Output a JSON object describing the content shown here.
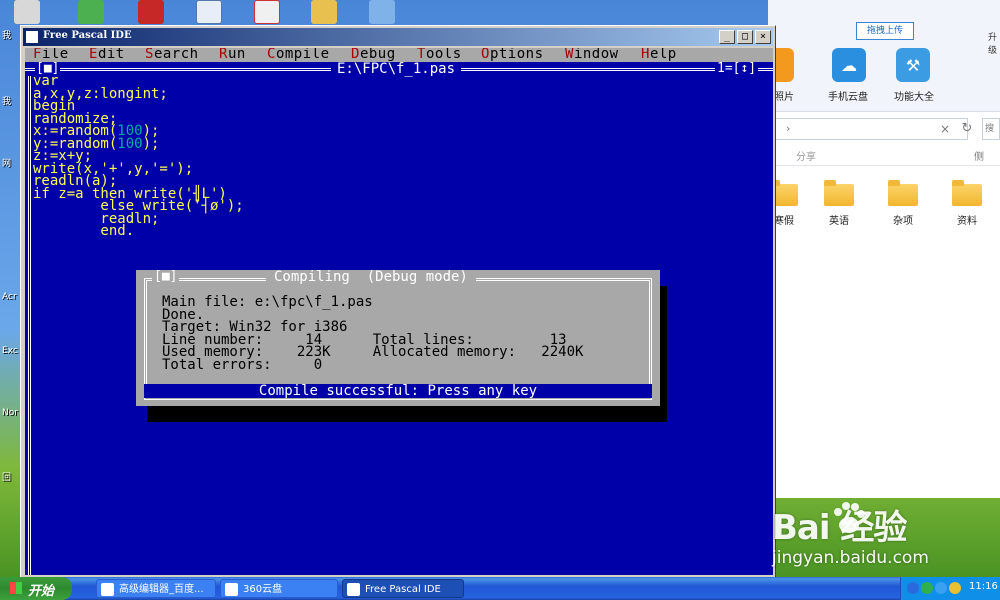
{
  "desktop": {
    "side_labels": [
      "我",
      "我",
      "网",
      "Acr",
      "Exc",
      "Nor",
      "回",
      "我"
    ],
    "icons": [
      "word-doc-icon",
      "pdf-icon",
      "wps-icon",
      "360-icon",
      "app-icon",
      "folder-icon"
    ]
  },
  "bg_window": {
    "upload_label": "拖拽上传",
    "right_tag": "升级",
    "tools": [
      {
        "label": "照片",
        "icon": "photo-icon",
        "color": "#f39a1e"
      },
      {
        "label": "手机云盘",
        "icon": "cloud-icon",
        "color": "#2b8fe0"
      },
      {
        "label": "功能大全",
        "icon": "tools-icon",
        "color": "#3b9ce4"
      }
    ],
    "search_placeholder": "搜",
    "share_label": "分享",
    "view_label": "侧",
    "folders": [
      "寒假",
      "英语",
      "杂项",
      "资料"
    ]
  },
  "ide": {
    "window_title": "Free Pascal IDE",
    "menu": [
      {
        "hot": "F",
        "rest": "ile"
      },
      {
        "hot": "E",
        "rest": "dit"
      },
      {
        "hot": "S",
        "rest": "earch"
      },
      {
        "hot": "R",
        "rest": "un"
      },
      {
        "hot": "C",
        "rest": "ompile"
      },
      {
        "hot": "D",
        "rest": "ebug"
      },
      {
        "hot": "T",
        "rest": "ools"
      },
      {
        "hot": "O",
        "rest": "ptions"
      },
      {
        "hot": "W",
        "rest": "indow"
      },
      {
        "hot": "H",
        "rest": "elp"
      }
    ],
    "editor_close": "[■]",
    "file_name": "E:\\FPC\\f_1.pas",
    "window_number": "1=[↕]",
    "code_lines": [
      "var",
      "a,x,y,z:longint;",
      "begin",
      "randomize;",
      "x:=random(100);",
      "y:=random(100);",
      "z:=x+y;",
      "write(x,'+',y,'=');",
      "readln(a);",
      "if z=a then write('╢L')",
      "        else write('┤ø');",
      "        readln;",
      "        end."
    ],
    "dialog": {
      "close": "[■]",
      "title": "Compiling  (Debug mode)",
      "lines": [
        "Main file: e:\\fpc\\f_1.pas",
        "Done.",
        "Target: Win32 for i386",
        "Line number:     14      Total lines:         13",
        "Used memory:    223K     Allocated memory:   2240K",
        "Total errors:     0"
      ],
      "status": "Compile successful: Press any key"
    }
  },
  "taskbar": {
    "start_label": "开始",
    "tasks": [
      {
        "label": "高级编辑器_百度...",
        "active": false
      },
      {
        "label": "360云盘",
        "active": false
      },
      {
        "label": "Free Pascal IDE",
        "active": true
      }
    ],
    "clock": "11:16"
  },
  "watermark": {
    "logo": "Bai  经验",
    "url": "jingyan.baidu.com"
  }
}
